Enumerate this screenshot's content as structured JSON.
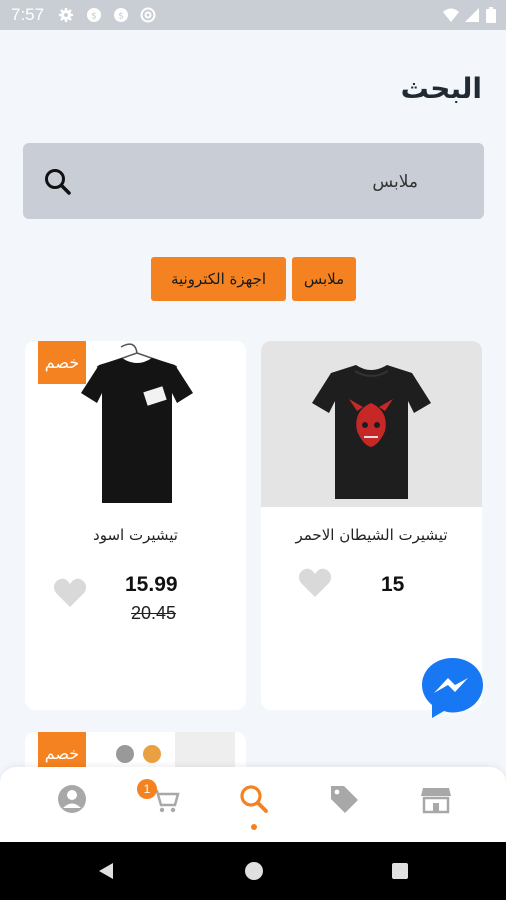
{
  "status_bar": {
    "time": "7:57"
  },
  "header": {
    "title": "البحث"
  },
  "search": {
    "value": "ملابس"
  },
  "categories": [
    {
      "label": "ملابس"
    },
    {
      "label": "اجهزة الكترونية"
    }
  ],
  "products": [
    {
      "name": "تيشيرت الشيطان الاحمر",
      "price": "15",
      "old_price": ""
    },
    {
      "name": "تيشيرت اسود",
      "price": "15.99",
      "old_price": "20.45",
      "badge": "خصم"
    },
    {
      "badge": "خصم"
    }
  ],
  "bottom_nav": {
    "cart_count": "1",
    "items": [
      "profile-icon",
      "cart-icon",
      "search-icon",
      "tag-icon",
      "store-icon"
    ],
    "active": "search"
  },
  "colors": {
    "accent": "#f58220",
    "search_bg": "#c9ced6",
    "page_bg": "#f3f7fb"
  }
}
